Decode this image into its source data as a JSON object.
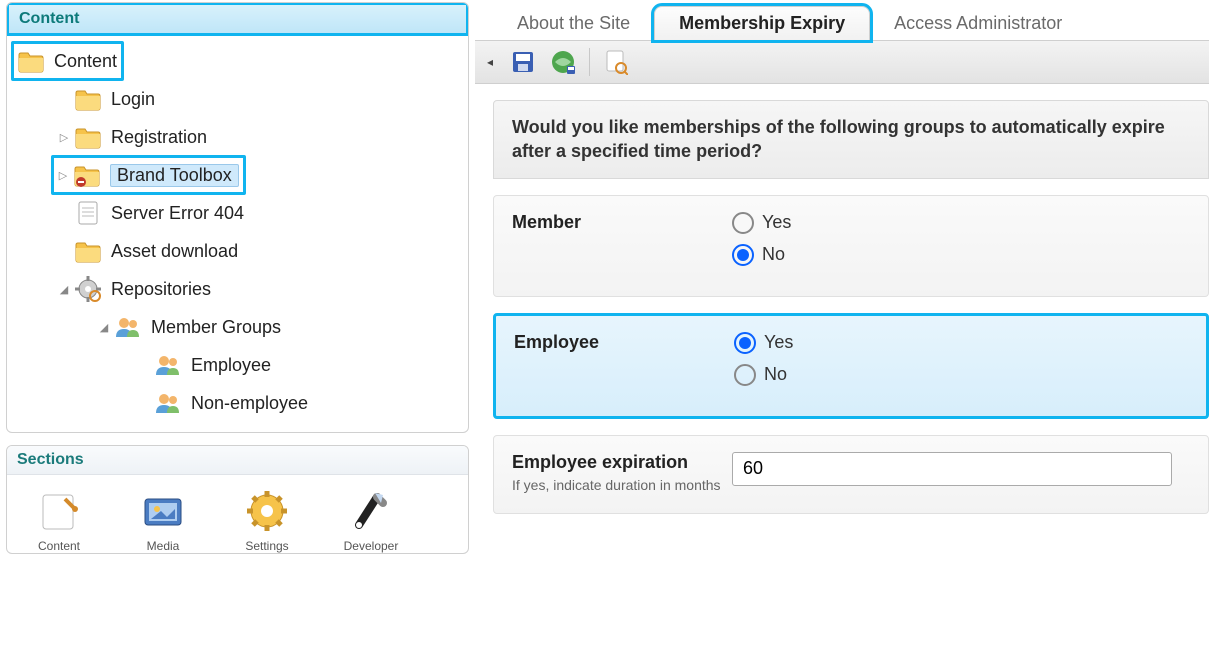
{
  "sidebar": {
    "content_header": "Content",
    "items": [
      {
        "label": "Content",
        "icon": "folder",
        "level": 0,
        "highlight": true
      },
      {
        "label": "Login",
        "icon": "folder",
        "level": 1
      },
      {
        "label": "Registration",
        "icon": "folder",
        "level": 1,
        "expander": "▷"
      },
      {
        "label": "Brand Toolbox",
        "icon": "folder-restricted",
        "level": 1,
        "expander": "▷",
        "selected": true,
        "boxed": true
      },
      {
        "label": "Server Error 404",
        "icon": "page",
        "level": 1
      },
      {
        "label": "Asset download",
        "icon": "folder",
        "level": 1
      },
      {
        "label": "Repositories",
        "icon": "gear",
        "level": 1,
        "expander": "◢"
      },
      {
        "label": "Member Groups",
        "icon": "people",
        "level": 2,
        "expander": "◢"
      },
      {
        "label": "Employee",
        "icon": "people",
        "level": 3
      },
      {
        "label": "Non-employee",
        "icon": "people",
        "level": 3
      }
    ],
    "sections_header": "Sections",
    "sections": [
      {
        "label": "Content",
        "icon": "content"
      },
      {
        "label": "Media",
        "icon": "media"
      },
      {
        "label": "Settings",
        "icon": "settings"
      },
      {
        "label": "Developer",
        "icon": "developer"
      }
    ]
  },
  "tabs": [
    {
      "label": "About the Site",
      "active": false
    },
    {
      "label": "Membership Expiry",
      "active": true,
      "highlight": true
    },
    {
      "label": "Access Administrator",
      "active": false
    }
  ],
  "toolbar": {
    "back": "◂",
    "save": "save-icon",
    "save_publish": "save-publish-icon",
    "preview": "preview-icon"
  },
  "form": {
    "question": "Would you like memberships of the following groups to automatically expire after a specified time period?",
    "groups": [
      {
        "name": "Member",
        "value": "No",
        "highlight": false
      },
      {
        "name": "Employee",
        "value": "Yes",
        "highlight": true
      }
    ],
    "yes_label": "Yes",
    "no_label": "No",
    "expiration_label": "Employee expiration",
    "expiration_help": "If yes, indicate duration in months",
    "expiration_value": "60"
  }
}
